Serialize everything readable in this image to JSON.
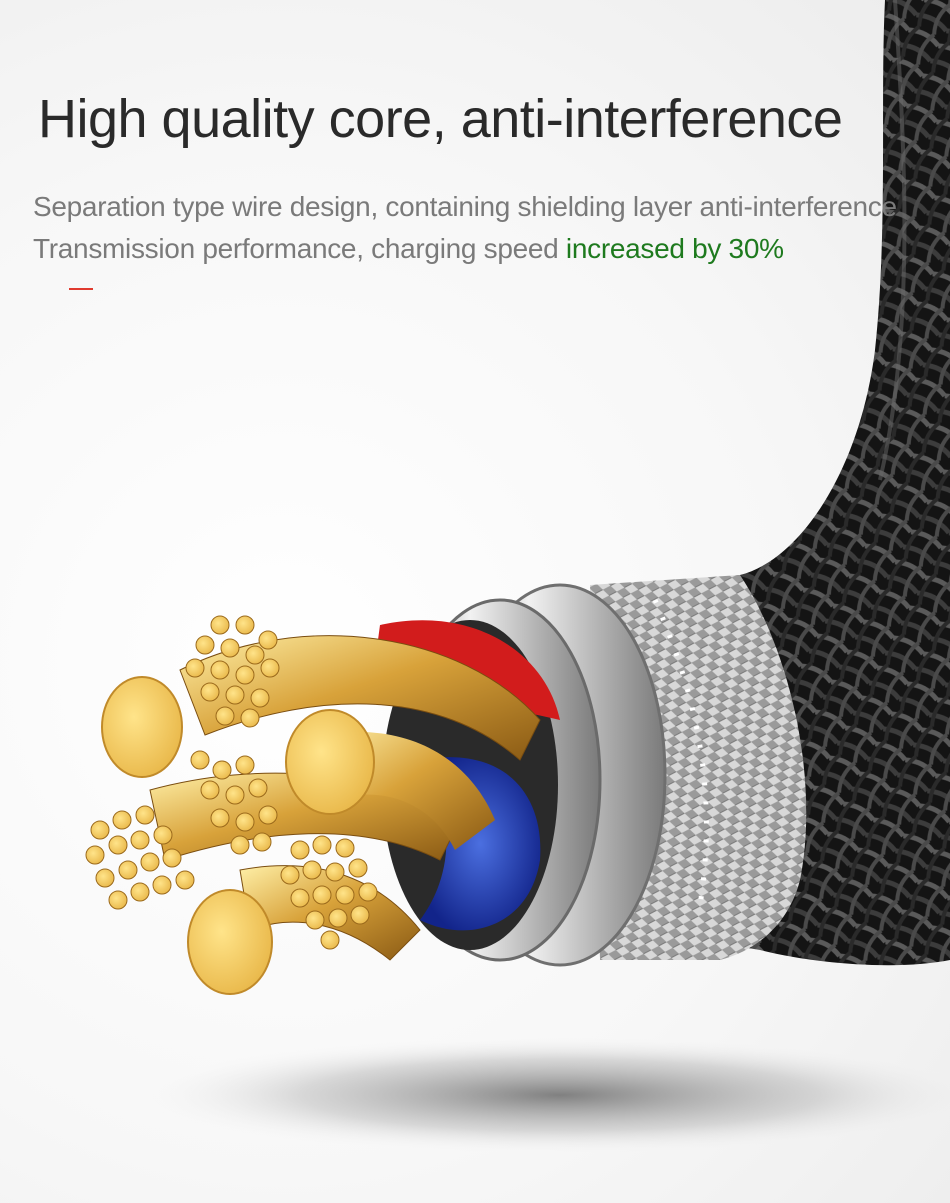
{
  "headline": "High quality core, anti-interference",
  "description": {
    "line1": "Separation type wire design, containing shielding layer anti-interference",
    "line2_prefix": "Transmission performance, charging speed ",
    "line2_highlight": "increased by 30%"
  },
  "colors": {
    "headline": "#2a2a2a",
    "body_text": "#7a7a7a",
    "highlight": "#1e7a1e",
    "accent_dash": "#e03a2e",
    "copper": "#d9a33a",
    "copper_face": "#f3cf6a",
    "braid": "#1c1c1c",
    "red_insulation": "#d21c1c",
    "blue_insulation": "#1f3fb8",
    "aluminum_shield": "#b9b9b9"
  },
  "illustration": {
    "subject": "braided-cable-cross-section"
  }
}
